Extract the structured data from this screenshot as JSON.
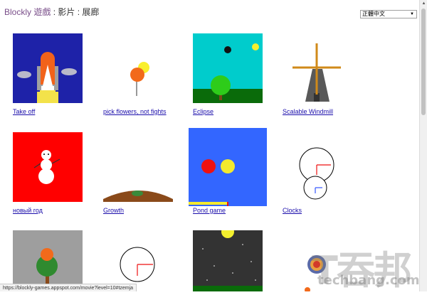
{
  "header": {
    "brand": "Blockly",
    "game": "遊戲",
    "sep1": " : ",
    "app": "影片",
    "sep2": " : ",
    "page": "展廊"
  },
  "language": {
    "selected": "正體中文"
  },
  "gallery": [
    {
      "label": "Take off"
    },
    {
      "label": "pick flowers, not fights"
    },
    {
      "label": "Eclipse"
    },
    {
      "label": "Scalable Windmill"
    },
    {
      "label": "новый год"
    },
    {
      "label": "Growth"
    },
    {
      "label": "Pond game"
    },
    {
      "label": "Clocks"
    }
  ],
  "status_bar": {
    "url": "https://blockly-games.appspot.com/movie?level=10#tzemja"
  },
  "watermark": {
    "text": "techbang.com"
  },
  "colors": {
    "link": "#1a0dab",
    "brand": "#7a4f8a"
  }
}
